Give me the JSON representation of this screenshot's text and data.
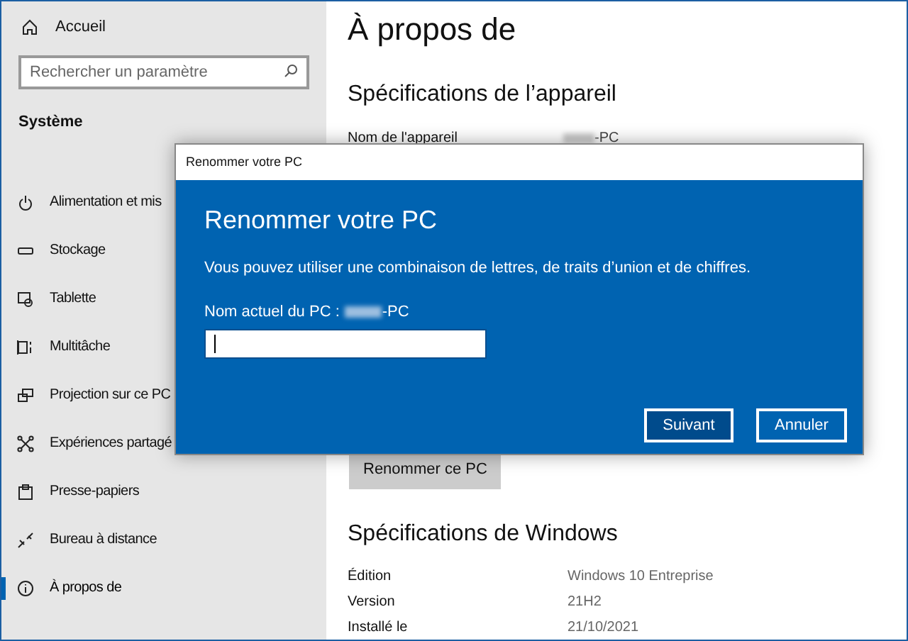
{
  "sidebar": {
    "home": "Accueil",
    "search": {
      "placeholder": "Rechercher un paramètre"
    },
    "section": "Système",
    "items": [
      {
        "label": "Alimentation et mis",
        "kind": "power",
        "selected": false
      },
      {
        "label": "Stockage",
        "kind": "storage",
        "selected": false
      },
      {
        "label": "Tablette",
        "kind": "tablet",
        "selected": false
      },
      {
        "label": "Multitâche",
        "kind": "multitask",
        "selected": false
      },
      {
        "label": "Projection sur ce PC",
        "kind": "project",
        "selected": false
      },
      {
        "label": "Expériences partagé",
        "kind": "share",
        "selected": false
      },
      {
        "label": "Presse-papiers",
        "kind": "clipboard",
        "selected": false
      },
      {
        "label": "Bureau à distance",
        "kind": "remote",
        "selected": false
      },
      {
        "label": "À propos de",
        "kind": "info",
        "selected": true
      }
    ]
  },
  "content": {
    "title": "À propos de",
    "device_heading": "Spécifications de l’appareil",
    "device_rows": [
      {
        "label": "Nom de l'appareil",
        "value": "-PC"
      }
    ],
    "rename_button": "Renommer ce PC",
    "windows_heading": "Spécifications de Windows",
    "windows_rows": [
      {
        "label": "Édition",
        "value": "Windows 10 Entreprise"
      },
      {
        "label": "Version",
        "value": "21H2"
      },
      {
        "label": "Installé le",
        "value": "21/10/2021"
      }
    ]
  },
  "dialog": {
    "title": "Renommer votre PC",
    "heading": "Renommer votre PC",
    "description": "Vous pouvez utiliser une combinaison de lettres, de traits d’union et de chiffres.",
    "current_label": "Nom actuel du PC :",
    "current_value": "-PC",
    "buttons": [
      {
        "label": "Suivant",
        "primary": true
      },
      {
        "label": "Annuler",
        "primary": false
      }
    ]
  }
}
